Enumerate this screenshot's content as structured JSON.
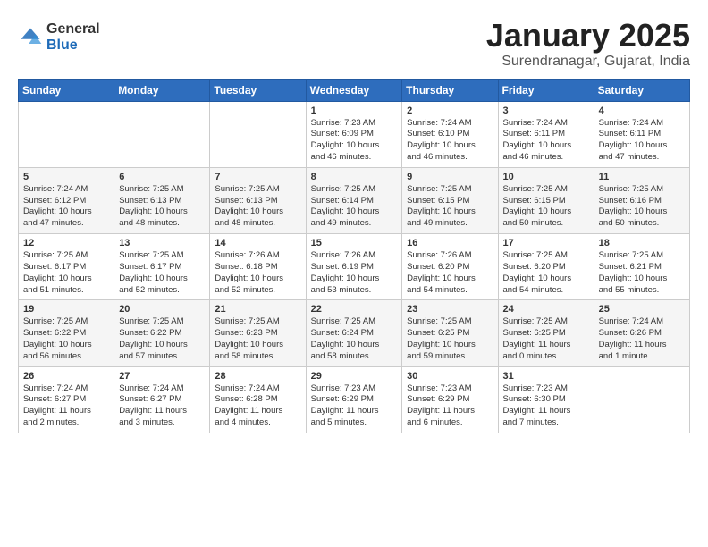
{
  "header": {
    "logo_general": "General",
    "logo_blue": "Blue",
    "month_title": "January 2025",
    "location": "Surendranagar, Gujarat, India"
  },
  "weekdays": [
    "Sunday",
    "Monday",
    "Tuesday",
    "Wednesday",
    "Thursday",
    "Friday",
    "Saturday"
  ],
  "weeks": [
    [
      {
        "day": "",
        "content": ""
      },
      {
        "day": "",
        "content": ""
      },
      {
        "day": "",
        "content": ""
      },
      {
        "day": "1",
        "content": "Sunrise: 7:23 AM\nSunset: 6:09 PM\nDaylight: 10 hours\nand 46 minutes."
      },
      {
        "day": "2",
        "content": "Sunrise: 7:24 AM\nSunset: 6:10 PM\nDaylight: 10 hours\nand 46 minutes."
      },
      {
        "day": "3",
        "content": "Sunrise: 7:24 AM\nSunset: 6:11 PM\nDaylight: 10 hours\nand 46 minutes."
      },
      {
        "day": "4",
        "content": "Sunrise: 7:24 AM\nSunset: 6:11 PM\nDaylight: 10 hours\nand 47 minutes."
      }
    ],
    [
      {
        "day": "5",
        "content": "Sunrise: 7:24 AM\nSunset: 6:12 PM\nDaylight: 10 hours\nand 47 minutes."
      },
      {
        "day": "6",
        "content": "Sunrise: 7:25 AM\nSunset: 6:13 PM\nDaylight: 10 hours\nand 48 minutes."
      },
      {
        "day": "7",
        "content": "Sunrise: 7:25 AM\nSunset: 6:13 PM\nDaylight: 10 hours\nand 48 minutes."
      },
      {
        "day": "8",
        "content": "Sunrise: 7:25 AM\nSunset: 6:14 PM\nDaylight: 10 hours\nand 49 minutes."
      },
      {
        "day": "9",
        "content": "Sunrise: 7:25 AM\nSunset: 6:15 PM\nDaylight: 10 hours\nand 49 minutes."
      },
      {
        "day": "10",
        "content": "Sunrise: 7:25 AM\nSunset: 6:15 PM\nDaylight: 10 hours\nand 50 minutes."
      },
      {
        "day": "11",
        "content": "Sunrise: 7:25 AM\nSunset: 6:16 PM\nDaylight: 10 hours\nand 50 minutes."
      }
    ],
    [
      {
        "day": "12",
        "content": "Sunrise: 7:25 AM\nSunset: 6:17 PM\nDaylight: 10 hours\nand 51 minutes."
      },
      {
        "day": "13",
        "content": "Sunrise: 7:25 AM\nSunset: 6:17 PM\nDaylight: 10 hours\nand 52 minutes."
      },
      {
        "day": "14",
        "content": "Sunrise: 7:26 AM\nSunset: 6:18 PM\nDaylight: 10 hours\nand 52 minutes."
      },
      {
        "day": "15",
        "content": "Sunrise: 7:26 AM\nSunset: 6:19 PM\nDaylight: 10 hours\nand 53 minutes."
      },
      {
        "day": "16",
        "content": "Sunrise: 7:26 AM\nSunset: 6:20 PM\nDaylight: 10 hours\nand 54 minutes."
      },
      {
        "day": "17",
        "content": "Sunrise: 7:25 AM\nSunset: 6:20 PM\nDaylight: 10 hours\nand 54 minutes."
      },
      {
        "day": "18",
        "content": "Sunrise: 7:25 AM\nSunset: 6:21 PM\nDaylight: 10 hours\nand 55 minutes."
      }
    ],
    [
      {
        "day": "19",
        "content": "Sunrise: 7:25 AM\nSunset: 6:22 PM\nDaylight: 10 hours\nand 56 minutes."
      },
      {
        "day": "20",
        "content": "Sunrise: 7:25 AM\nSunset: 6:22 PM\nDaylight: 10 hours\nand 57 minutes."
      },
      {
        "day": "21",
        "content": "Sunrise: 7:25 AM\nSunset: 6:23 PM\nDaylight: 10 hours\nand 58 minutes."
      },
      {
        "day": "22",
        "content": "Sunrise: 7:25 AM\nSunset: 6:24 PM\nDaylight: 10 hours\nand 58 minutes."
      },
      {
        "day": "23",
        "content": "Sunrise: 7:25 AM\nSunset: 6:25 PM\nDaylight: 10 hours\nand 59 minutes."
      },
      {
        "day": "24",
        "content": "Sunrise: 7:25 AM\nSunset: 6:25 PM\nDaylight: 11 hours\nand 0 minutes."
      },
      {
        "day": "25",
        "content": "Sunrise: 7:24 AM\nSunset: 6:26 PM\nDaylight: 11 hours\nand 1 minute."
      }
    ],
    [
      {
        "day": "26",
        "content": "Sunrise: 7:24 AM\nSunset: 6:27 PM\nDaylight: 11 hours\nand 2 minutes."
      },
      {
        "day": "27",
        "content": "Sunrise: 7:24 AM\nSunset: 6:27 PM\nDaylight: 11 hours\nand 3 minutes."
      },
      {
        "day": "28",
        "content": "Sunrise: 7:24 AM\nSunset: 6:28 PM\nDaylight: 11 hours\nand 4 minutes."
      },
      {
        "day": "29",
        "content": "Sunrise: 7:23 AM\nSunset: 6:29 PM\nDaylight: 11 hours\nand 5 minutes."
      },
      {
        "day": "30",
        "content": "Sunrise: 7:23 AM\nSunset: 6:29 PM\nDaylight: 11 hours\nand 6 minutes."
      },
      {
        "day": "31",
        "content": "Sunrise: 7:23 AM\nSunset: 6:30 PM\nDaylight: 11 hours\nand 7 minutes."
      },
      {
        "day": "",
        "content": ""
      }
    ]
  ]
}
